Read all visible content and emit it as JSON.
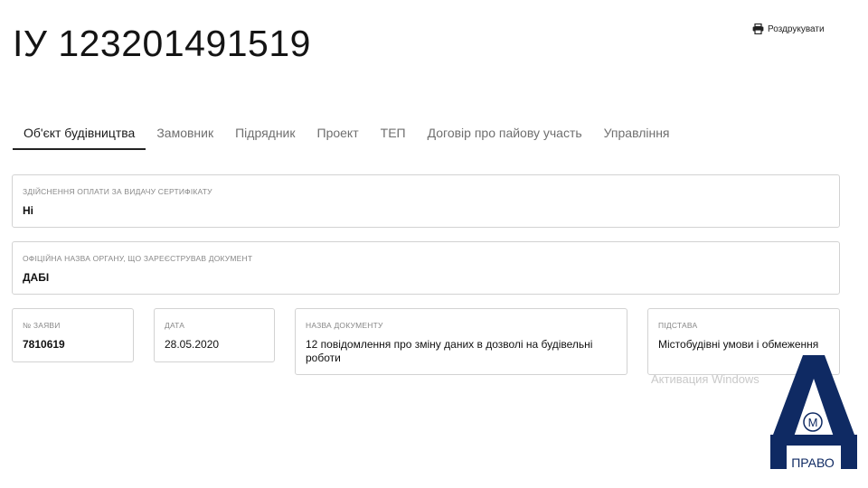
{
  "document": {
    "title": "ІУ 123201491519"
  },
  "toolbar": {
    "print_label": "Роздрукувати",
    "print_icon": "printer-icon"
  },
  "tabs": [
    {
      "label": "Об'єкт будівництва",
      "active": true
    },
    {
      "label": "Замовник",
      "active": false
    },
    {
      "label": "Підрядник",
      "active": false
    },
    {
      "label": "Проект",
      "active": false
    },
    {
      "label": "ТЕП",
      "active": false
    },
    {
      "label": "Договір про пайову участь",
      "active": false
    },
    {
      "label": "Управління",
      "active": false
    }
  ],
  "fields": {
    "payment": {
      "label": "Здійснення оплати за видачу сертифікату",
      "value": "Ні"
    },
    "authority": {
      "label": "Офіційна назва органу, що зареєстрував документ",
      "value": "ДАБІ"
    },
    "application_no": {
      "label": "№ заяви",
      "value": "7810619"
    },
    "date": {
      "label": "Дата",
      "value": "28.05.2020"
    },
    "document_name": {
      "label": "Назва документу",
      "value": "12 повідомлення про зміну даних в дозволі на будівельні роботи"
    },
    "basis": {
      "label": "Підстава",
      "value": "Містобудівні умови і обмеження"
    }
  },
  "watermark": {
    "text": "Активация Windows"
  },
  "logo": {
    "text": "ПРАВО",
    "circle_letter": "М",
    "color": "#0f2a63"
  }
}
